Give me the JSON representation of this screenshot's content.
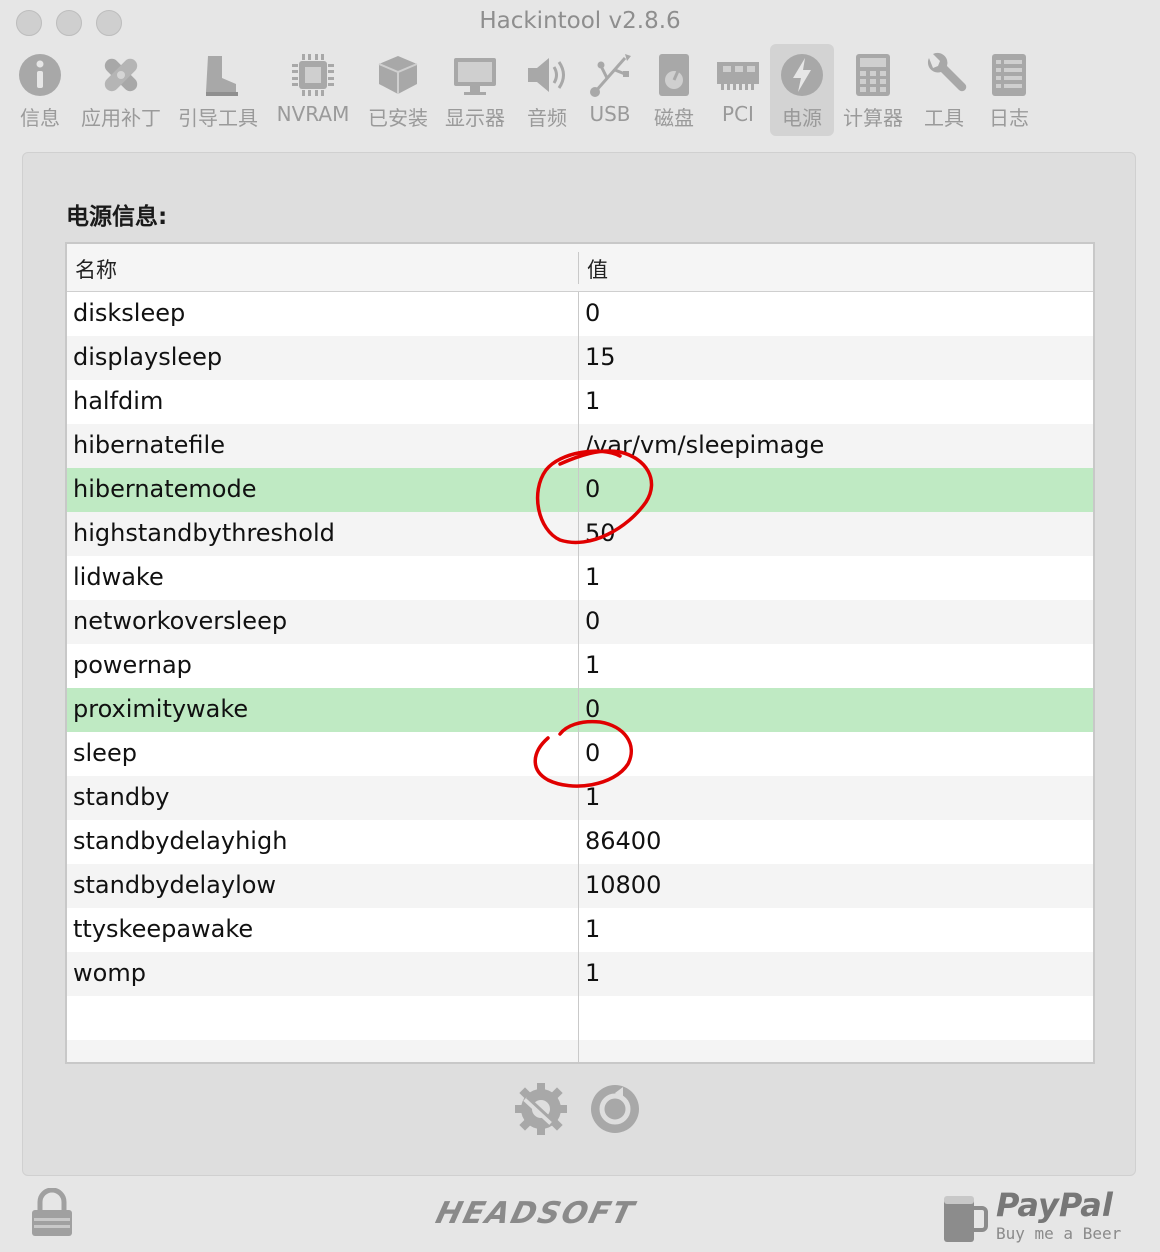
{
  "window": {
    "title": "Hackintool v2.8.6"
  },
  "toolbar": {
    "items": [
      {
        "label": "信息",
        "icon": "info-icon"
      },
      {
        "label": "应用补丁",
        "icon": "bandage-icon"
      },
      {
        "label": "引导工具",
        "icon": "boot-icon"
      },
      {
        "label": "NVRAM",
        "icon": "chip-icon"
      },
      {
        "label": "已安装",
        "icon": "package-icon"
      },
      {
        "label": "显示器",
        "icon": "display-icon"
      },
      {
        "label": "音频",
        "icon": "speaker-icon"
      },
      {
        "label": "USB",
        "icon": "usb-icon"
      },
      {
        "label": "磁盘",
        "icon": "disk-icon"
      },
      {
        "label": "PCI",
        "icon": "pci-card-icon"
      },
      {
        "label": "电源",
        "icon": "power-bolt-icon",
        "active": true
      },
      {
        "label": "计算器",
        "icon": "calculator-icon"
      },
      {
        "label": "工具",
        "icon": "wrench-icon"
      },
      {
        "label": "日志",
        "icon": "log-list-icon"
      }
    ]
  },
  "main": {
    "section_title": "电源信息:",
    "columns": [
      "名称",
      "值"
    ],
    "rows": [
      {
        "name": "disksleep",
        "value": "0"
      },
      {
        "name": "displaysleep",
        "value": "15"
      },
      {
        "name": "halfdim",
        "value": "1"
      },
      {
        "name": "hibernatefile",
        "value": "/var/vm/sleepimage"
      },
      {
        "name": "hibernatemode",
        "value": "0",
        "highlight": true
      },
      {
        "name": "highstandbythreshold",
        "value": "50"
      },
      {
        "name": "lidwake",
        "value": "1"
      },
      {
        "name": "networkoversleep",
        "value": "0"
      },
      {
        "name": "powernap",
        "value": "1"
      },
      {
        "name": "proximitywake",
        "value": "0",
        "highlight": true
      },
      {
        "name": "sleep",
        "value": "0"
      },
      {
        "name": "standby",
        "value": "1"
      },
      {
        "name": "standbydelayhigh",
        "value": "86400"
      },
      {
        "name": "standbydelaylow",
        "value": "10800"
      },
      {
        "name": "ttyskeepawake",
        "value": "1"
      },
      {
        "name": "womp",
        "value": "1"
      },
      {
        "name": "",
        "value": ""
      },
      {
        "name": "",
        "value": ""
      }
    ]
  },
  "footer": {
    "brand": "HEADSOFT",
    "paypal": "PayPal",
    "paypal_sub": "Buy me a Beer"
  },
  "colors": {
    "highlight_row": "#bfeac3",
    "annotation": "#e00000",
    "icon_gray": "#a8a8a8"
  }
}
